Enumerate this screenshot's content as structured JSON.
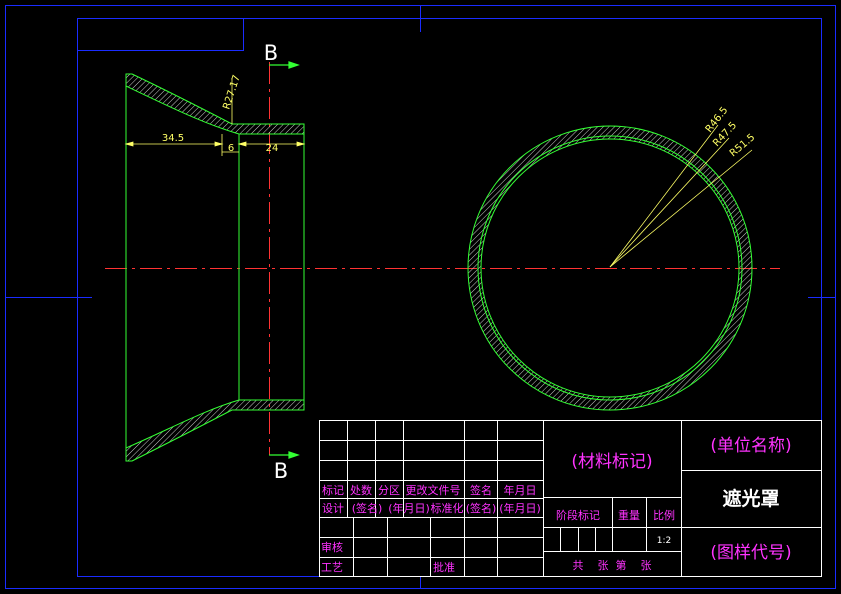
{
  "colors": {
    "background": "#000000",
    "frame": "#1a2cff",
    "outline": "#33ff33",
    "center_line": "#ff3333",
    "dimension": "#ffff66",
    "title_block_text": "#ff33ff",
    "title_block_lines": "#ffffff"
  },
  "section": {
    "label_top": "B",
    "label_bottom": "B"
  },
  "dimensions": {
    "left_length": "34.5",
    "step": "6",
    "neck_length": "24",
    "neck_radius": "R27.17",
    "r_inner": "R46.5",
    "r_mid": "R47.5",
    "r_outer": "R51.5"
  },
  "title_block": {
    "material_mark": "(材料标记)",
    "unit_name": "(单位名称)",
    "part_name": "遮光罩",
    "drawing_code": "(图样代号)",
    "row_headers": [
      "标记",
      "处数",
      "分区",
      "更改文件号",
      "签名",
      "年月日"
    ],
    "design_row": [
      "设计",
      "(签名)",
      "(年月日)",
      "标准化",
      "(签名)",
      "(年月日)"
    ],
    "review": "审核",
    "process": "工艺",
    "approve": "批准",
    "stage_mark": "阶段标记",
    "weight": "重量",
    "scale_label": "比例",
    "scale_value": "1:2",
    "sheets": "共    张  第    张"
  }
}
